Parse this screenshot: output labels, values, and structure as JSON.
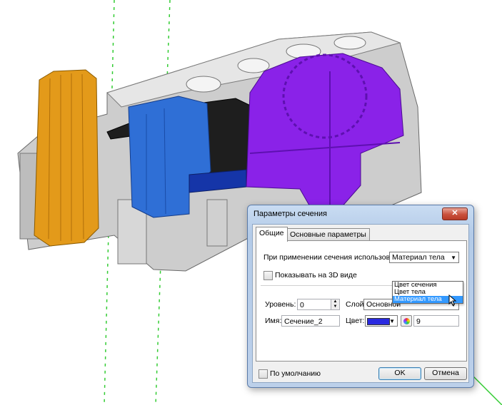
{
  "dialog": {
    "title": "Параметры сечения",
    "close_label": "✕",
    "tabs": [
      {
        "label": "Общие",
        "active": true
      },
      {
        "label": "Основные параметры",
        "active": false
      }
    ],
    "usage": {
      "label": "При применении сечения использовать:",
      "selected": "Материал тела",
      "options": [
        "Цвет сечения",
        "Цвет тела",
        "Материал тела"
      ]
    },
    "show_3d": {
      "label": "Показывать на 3D виде",
      "checked": false
    },
    "level": {
      "label": "Уровень:",
      "value": "0"
    },
    "layer": {
      "label": "Слой:",
      "value": "Основной"
    },
    "name": {
      "label": "Имя:",
      "value": "Сечение_2"
    },
    "color": {
      "label": "Цвет:",
      "swatch": "#2a2ae0",
      "index": "9"
    },
    "default_check": {
      "label": "По умолчанию",
      "checked": false
    },
    "ok_label": "OK",
    "cancel_label": "Отмена"
  },
  "colors": {
    "orange_part": "#e39a1a",
    "blue_part": "#2f6fd6",
    "purple_part": "#8a22e8",
    "body": "#c9c9c9",
    "section_line": "#33cc33"
  }
}
